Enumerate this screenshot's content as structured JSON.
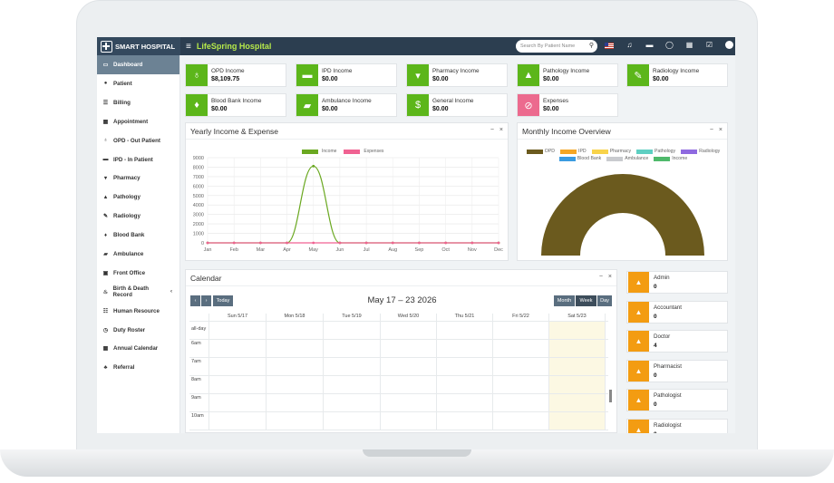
{
  "header": {
    "brand": "SMART HOSPITAL",
    "hospital_name": "LifeSpring Hospital",
    "search_placeholder": "Search By Patient Name"
  },
  "sidebar": {
    "items": [
      {
        "label": "Dashboard",
        "icon": "monitor-icon",
        "active": true
      },
      {
        "label": "Patient",
        "icon": "user-icon"
      },
      {
        "label": "Billing",
        "icon": "list-icon"
      },
      {
        "label": "Appointment",
        "icon": "calendar-check-icon"
      },
      {
        "label": "OPD - Out Patient",
        "icon": "stethoscope-icon"
      },
      {
        "label": "IPD - In Patient",
        "icon": "bed-icon"
      },
      {
        "label": "Pharmacy",
        "icon": "mortar-pestle-icon"
      },
      {
        "label": "Pathology",
        "icon": "flask-icon"
      },
      {
        "label": "Radiology",
        "icon": "microscope-icon"
      },
      {
        "label": "Blood Bank",
        "icon": "tint-icon"
      },
      {
        "label": "Ambulance",
        "icon": "ambulance-icon"
      },
      {
        "label": "Front Office",
        "icon": "dungeon-icon"
      },
      {
        "label": "Birth & Death Record",
        "icon": "birthday-cake-icon",
        "caret": "‹"
      },
      {
        "label": "Human Resource",
        "icon": "sitemap-icon"
      },
      {
        "label": "Duty Roster",
        "icon": "clock-icon"
      },
      {
        "label": "Annual Calendar",
        "icon": "calendar-icon"
      },
      {
        "label": "Referral",
        "icon": "users-icon"
      }
    ]
  },
  "income_cards": [
    {
      "label": "OPD Income",
      "value": "$8,109.75",
      "color": "#5cb61a",
      "icon": "stethoscope-icon"
    },
    {
      "label": "IPD Income",
      "value": "$0.00",
      "color": "#5cb61a",
      "icon": "bed-icon"
    },
    {
      "label": "Pharmacy Income",
      "value": "$0.00",
      "color": "#5cb61a",
      "icon": "mortar-pestle-icon"
    },
    {
      "label": "Pathology Income",
      "value": "$0.00",
      "color": "#5cb61a",
      "icon": "flask-icon"
    },
    {
      "label": "Radiology Income",
      "value": "$0.00",
      "color": "#5cb61a",
      "icon": "microscope-icon"
    },
    {
      "label": "Blood Bank Income",
      "value": "$0.00",
      "color": "#5cb61a",
      "icon": "tint-icon"
    },
    {
      "label": "Ambulance Income",
      "value": "$0.00",
      "color": "#5cb61a",
      "icon": "ambulance-icon"
    },
    {
      "label": "General Income",
      "value": "$0.00",
      "color": "#5cb61a",
      "icon": "money-icon"
    },
    {
      "label": "Expenses",
      "value": "$0.00",
      "color": "#ec6a8e",
      "icon": "money-off-icon"
    }
  ],
  "yearly": {
    "title": "Yearly Income & Expense",
    "legend": [
      "Income",
      "Expenses"
    ]
  },
  "monthly": {
    "title": "Monthly Income Overview",
    "legend": [
      {
        "label": "OPD",
        "color": "#6b5a1e"
      },
      {
        "label": "IPD",
        "color": "#f5a623"
      },
      {
        "label": "Pharmacy",
        "color": "#f8d34a"
      },
      {
        "label": "Pathology",
        "color": "#5ecfc2"
      },
      {
        "label": "Radiology",
        "color": "#8f6ae0"
      },
      {
        "label": "Blood Bank",
        "color": "#3b9be0"
      },
      {
        "label": "Ambulance",
        "color": "#c9cbcf"
      },
      {
        "label": "Income",
        "color": "#4fb96b"
      }
    ]
  },
  "calendar": {
    "title": "Calendar",
    "range": "May 17 – 23 2026",
    "today_label": "Today",
    "views": [
      "Month",
      "Week",
      "Day"
    ],
    "days": [
      "Sun 5/17",
      "Mon 5/18",
      "Tue 5/19",
      "Wed 5/20",
      "Thu 5/21",
      "Fri 5/22",
      "Sat 5/23"
    ],
    "allday": "all-day",
    "times": [
      "6am",
      "7am",
      "8am",
      "9am",
      "10am"
    ]
  },
  "staff": [
    {
      "role": "Admin",
      "count": "0"
    },
    {
      "role": "Accountant",
      "count": "0"
    },
    {
      "role": "Doctor",
      "count": "4"
    },
    {
      "role": "Pharmacist",
      "count": "0"
    },
    {
      "role": "Pathologist",
      "count": "0"
    },
    {
      "role": "Radiologist",
      "count": "0"
    }
  ],
  "chart_data": {
    "type": "line",
    "categories": [
      "Jan",
      "Feb",
      "Mar",
      "Apr",
      "May",
      "Jun",
      "Jul",
      "Aug",
      "Sep",
      "Oct",
      "Nov",
      "Dec"
    ],
    "series": [
      {
        "name": "Income",
        "color": "#6aa820",
        "values": [
          0,
          0,
          0,
          0,
          8110,
          0,
          0,
          0,
          0,
          0,
          0,
          0
        ]
      },
      {
        "name": "Expenses",
        "color": "#f06292",
        "values": [
          0,
          0,
          0,
          0,
          0,
          0,
          0,
          0,
          0,
          0,
          0,
          0
        ]
      }
    ],
    "yticks": [
      "0",
      "1000",
      "2000",
      "3000",
      "4000",
      "5000",
      "6000",
      "7000",
      "8000",
      "9000"
    ],
    "ylim": [
      0,
      9000
    ]
  }
}
